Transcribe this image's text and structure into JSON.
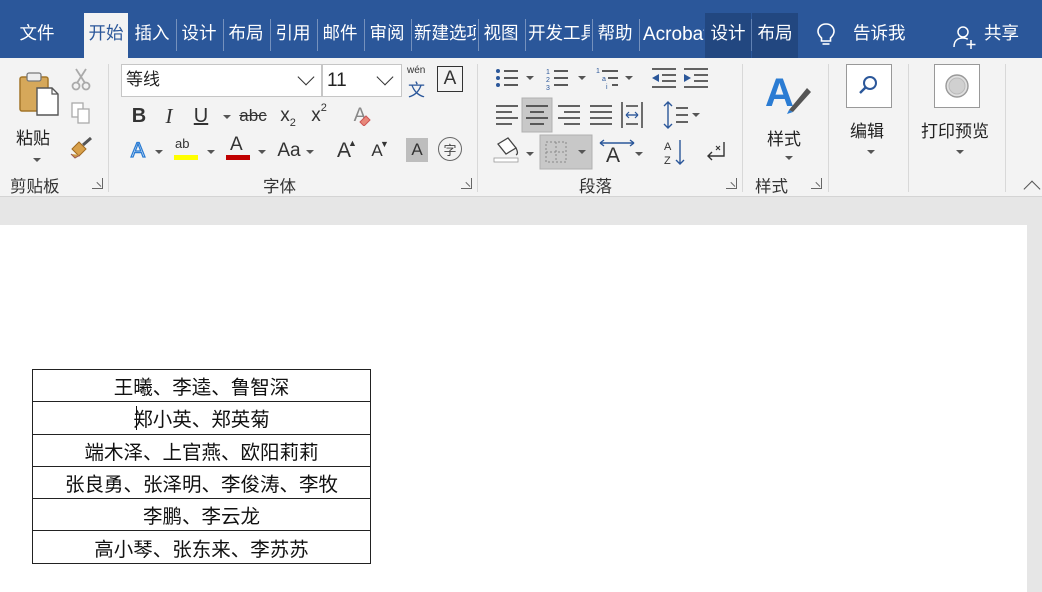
{
  "tabs": [
    {
      "label": "文件",
      "state": "normal"
    },
    {
      "label": "开始",
      "state": "active"
    },
    {
      "label": "插入",
      "state": "normal"
    },
    {
      "label": "设计",
      "state": "normal"
    },
    {
      "label": "布局",
      "state": "normal"
    },
    {
      "label": "引用",
      "state": "normal"
    },
    {
      "label": "邮件",
      "state": "normal"
    },
    {
      "label": "审阅",
      "state": "normal"
    },
    {
      "label": "新建选项卡",
      "state": "normal"
    },
    {
      "label": "视图",
      "state": "normal"
    },
    {
      "label": "开发工具",
      "state": "normal"
    },
    {
      "label": "帮助",
      "state": "normal"
    },
    {
      "label": "Acrobat",
      "state": "normal"
    },
    {
      "label": "设计",
      "state": "contextual"
    },
    {
      "label": "布局",
      "state": "contextual"
    }
  ],
  "tell_me": {
    "label": "告诉我",
    "icon": "lightbulb-icon"
  },
  "share": {
    "label": "共享",
    "icon": "person-add-icon"
  },
  "clipboard": {
    "group_label": "剪贴板",
    "paste_label": "粘贴",
    "cut_icon": "scissors-icon",
    "copy_icon": "copy-icon",
    "format_painter_icon": "paintbrush-icon"
  },
  "font": {
    "group_label": "字体",
    "font_name": "等线",
    "font_size": "11",
    "phonetic_top": "wén",
    "phonetic_bottom": "文",
    "border_char": "A",
    "bold": "B",
    "italic": "I",
    "underline": "U",
    "strike": "abc",
    "subscript": "x",
    "subscript_small": "2",
    "superscript": "x",
    "superscript_small": "2",
    "clear_format_char": "A",
    "effects_char": "A",
    "highlight_text": "ab",
    "font_color_char": "A",
    "change_case": "Aa",
    "grow_char": "A",
    "shrink_char": "A",
    "shading_char": "A",
    "enclose_char": "字",
    "highlight_color": "#ffff00",
    "font_color": "#c00000"
  },
  "paragraph": {
    "group_label": "段落",
    "sort_top": "A",
    "sort_bottom": "Z"
  },
  "styles": {
    "group_label": "样式",
    "button_label": "样式"
  },
  "editing": {
    "button_label": "编辑"
  },
  "print_preview": {
    "button_label": "打印预览"
  },
  "document": {
    "table_rows": [
      "王曦、李逵、鲁智深",
      "郑小英、郑英菊",
      "端木泽、上官燕、欧阳莉莉",
      "张良勇、张泽明、李俊涛、李牧",
      "李鹏、李云龙",
      "高小琴、张东来、李苏苏"
    ]
  }
}
